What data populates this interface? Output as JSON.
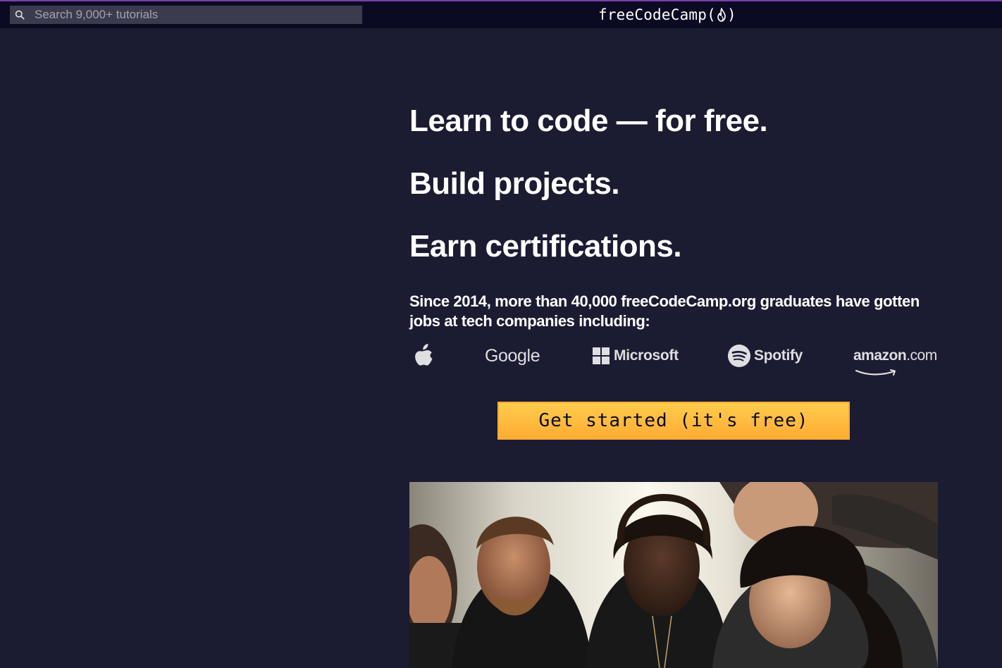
{
  "navbar": {
    "search_placeholder": "Search 9,000+ tutorials",
    "brand_text": "freeCodeCamp(",
    "brand_close": ")"
  },
  "hero": {
    "headline_1": "Learn to code — for free.",
    "headline_2": "Build projects.",
    "headline_3": "Earn certifications.",
    "subtext": "Since 2014, more than 40,000 freeCodeCamp.org graduates have gotten jobs at tech companies including:",
    "companies": {
      "google": "Google",
      "microsoft": "Microsoft",
      "spotify": "Spotify",
      "amazon_main": "amazon",
      "amazon_suffix": ".com"
    },
    "cta_label": "Get started (it's free)"
  },
  "icons": {
    "search": "search-icon",
    "flame": "flame-icon",
    "apple": "apple-logo"
  },
  "colors": {
    "background": "#1b1b32",
    "navbar": "#0a0a23",
    "cta": "#feac32",
    "text": "#ffffff"
  }
}
